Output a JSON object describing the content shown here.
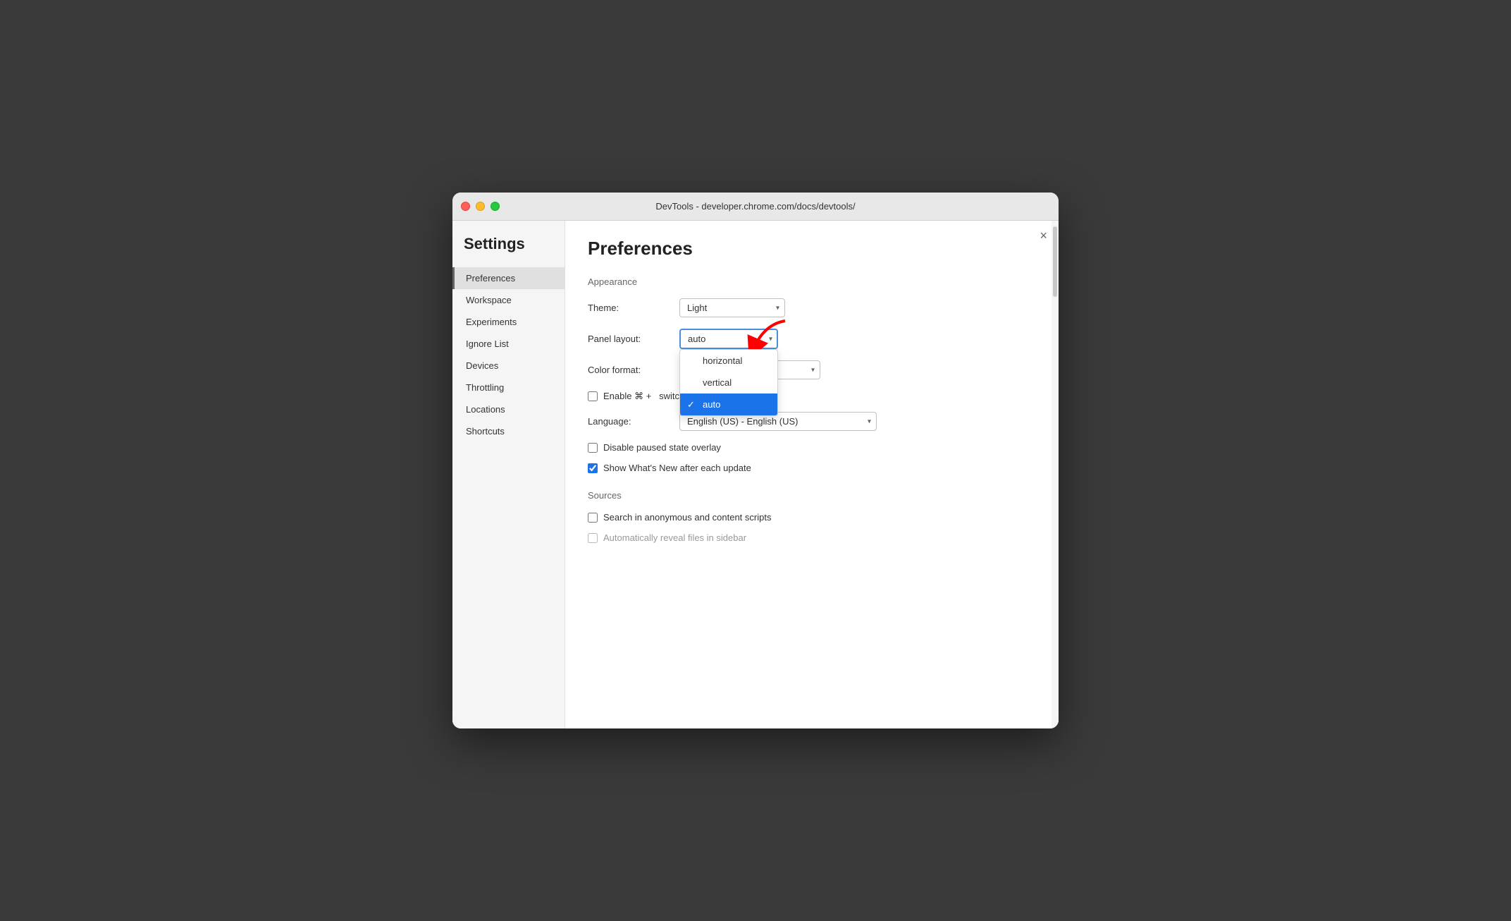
{
  "window": {
    "titlebar": {
      "title": "DevTools - developer.chrome.com/docs/devtools/"
    },
    "close_button": "×"
  },
  "sidebar": {
    "settings_title": "Settings",
    "items": [
      {
        "id": "preferences",
        "label": "Preferences",
        "active": true
      },
      {
        "id": "workspace",
        "label": "Workspace",
        "active": false
      },
      {
        "id": "experiments",
        "label": "Experiments",
        "active": false
      },
      {
        "id": "ignore-list",
        "label": "Ignore List",
        "active": false
      },
      {
        "id": "devices",
        "label": "Devices",
        "active": false
      },
      {
        "id": "throttling",
        "label": "Throttling",
        "active": false
      },
      {
        "id": "locations",
        "label": "Locations",
        "active": false
      },
      {
        "id": "shortcuts",
        "label": "Shortcuts",
        "active": false
      }
    ]
  },
  "main": {
    "page_title": "Preferences",
    "sections": {
      "appearance": {
        "title": "Appearance",
        "theme_label": "Theme:",
        "theme_value": "Light",
        "panel_layout_label": "Panel layout:",
        "panel_layout_value": "auto",
        "color_format_label": "Color format:",
        "language_label": "Language:",
        "language_value": "English (US) - English (US)"
      },
      "checkboxes": {
        "disable_paused": "Disable paused state overlay",
        "show_whats_new": "Show What's New after each update",
        "enable_shortcut": "Enable ⌘ +  switch panels"
      },
      "sources": {
        "title": "Sources",
        "search_anonymous": "Search in anonymous and content scripts"
      }
    },
    "dropdown": {
      "items": [
        {
          "label": "horizontal",
          "selected": false
        },
        {
          "label": "vertical",
          "selected": false
        },
        {
          "label": "auto",
          "selected": true
        }
      ]
    }
  }
}
